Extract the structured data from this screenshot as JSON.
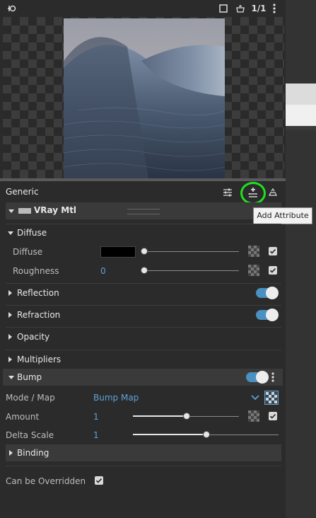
{
  "preview": {
    "ratio": "1/1"
  },
  "section_generic": "Generic",
  "material": {
    "name": "VRay Mtl"
  },
  "tooltip": "Add Attribute",
  "diffuse_group": {
    "title": "Diffuse",
    "diffuse_label": "Diffuse",
    "diffuse_color": "#000000",
    "roughness_label": "Roughness",
    "roughness_value": "0"
  },
  "collapsed": [
    "Reflection",
    "Refraction",
    "Opacity",
    "Multipliers"
  ],
  "bump": {
    "title": "Bump",
    "mode_label": "Mode / Map",
    "mode_value": "Bump Map",
    "amount_label": "Amount",
    "amount_value": "1",
    "delta_label": "Delta Scale",
    "delta_value": "1"
  },
  "binding": "Binding",
  "override_label": "Can be Overridden",
  "colors": {
    "accent": "#5ea1d8",
    "toggle_on": "#4a90c0",
    "highlight": "#20e020"
  }
}
